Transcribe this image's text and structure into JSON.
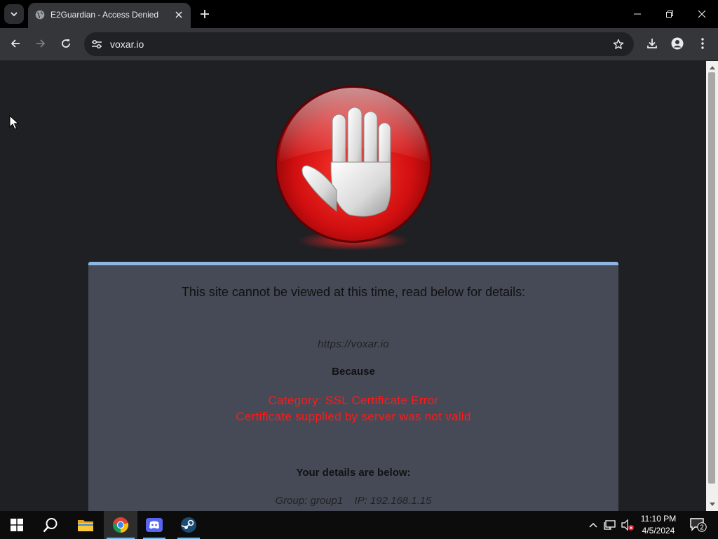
{
  "browser": {
    "tab_title": "E2Guardian - Access Denied",
    "url": "voxar.io"
  },
  "page": {
    "heading": "This site cannot be viewed at this time, read below for details:",
    "blocked_url": "https://voxar.io",
    "because_label": "Because",
    "reason_line1": "Category: SSL Certificate Error",
    "reason_line2": "Certificate supplied by server was not valid",
    "details_title": "Your details are below:",
    "group": "Group: group1",
    "ip": "IP: 192.168.1.15"
  },
  "taskbar": {
    "apps": [
      "start-icon",
      "search-icon",
      "file-explorer-icon",
      "chrome-icon",
      "discord-icon",
      "steam-icon"
    ],
    "clock_time": "11:10 PM",
    "clock_date": "4/5/2024",
    "notification_count": "2"
  },
  "colors": {
    "panel_bg": "#454a56",
    "panel_border": "#8fb6e3",
    "reason_text": "#ff1a1a",
    "page_bg": "#1e2024"
  }
}
